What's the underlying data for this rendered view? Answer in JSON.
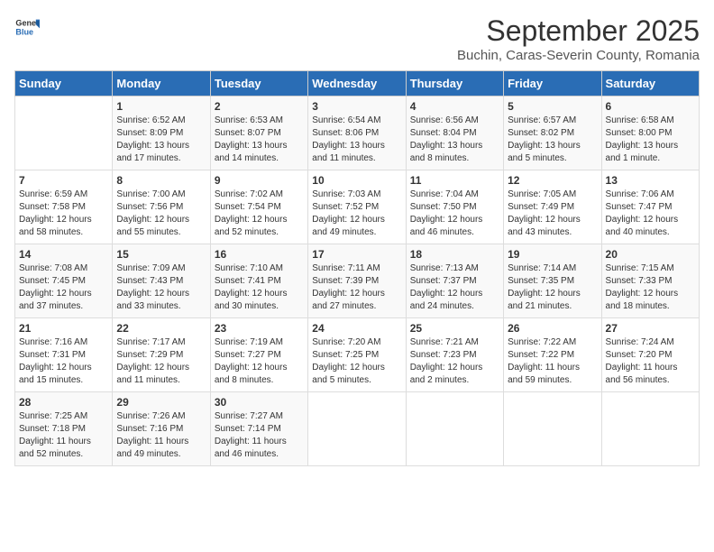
{
  "header": {
    "logo_general": "General",
    "logo_blue": "Blue",
    "title": "September 2025",
    "subtitle": "Buchin, Caras-Severin County, Romania"
  },
  "calendar": {
    "days_of_week": [
      "Sunday",
      "Monday",
      "Tuesday",
      "Wednesday",
      "Thursday",
      "Friday",
      "Saturday"
    ],
    "weeks": [
      [
        {
          "day": "",
          "content": ""
        },
        {
          "day": "1",
          "content": "Sunrise: 6:52 AM\nSunset: 8:09 PM\nDaylight: 13 hours\nand 17 minutes."
        },
        {
          "day": "2",
          "content": "Sunrise: 6:53 AM\nSunset: 8:07 PM\nDaylight: 13 hours\nand 14 minutes."
        },
        {
          "day": "3",
          "content": "Sunrise: 6:54 AM\nSunset: 8:06 PM\nDaylight: 13 hours\nand 11 minutes."
        },
        {
          "day": "4",
          "content": "Sunrise: 6:56 AM\nSunset: 8:04 PM\nDaylight: 13 hours\nand 8 minutes."
        },
        {
          "day": "5",
          "content": "Sunrise: 6:57 AM\nSunset: 8:02 PM\nDaylight: 13 hours\nand 5 minutes."
        },
        {
          "day": "6",
          "content": "Sunrise: 6:58 AM\nSunset: 8:00 PM\nDaylight: 13 hours\nand 1 minute."
        }
      ],
      [
        {
          "day": "7",
          "content": "Sunrise: 6:59 AM\nSunset: 7:58 PM\nDaylight: 12 hours\nand 58 minutes."
        },
        {
          "day": "8",
          "content": "Sunrise: 7:00 AM\nSunset: 7:56 PM\nDaylight: 12 hours\nand 55 minutes."
        },
        {
          "day": "9",
          "content": "Sunrise: 7:02 AM\nSunset: 7:54 PM\nDaylight: 12 hours\nand 52 minutes."
        },
        {
          "day": "10",
          "content": "Sunrise: 7:03 AM\nSunset: 7:52 PM\nDaylight: 12 hours\nand 49 minutes."
        },
        {
          "day": "11",
          "content": "Sunrise: 7:04 AM\nSunset: 7:50 PM\nDaylight: 12 hours\nand 46 minutes."
        },
        {
          "day": "12",
          "content": "Sunrise: 7:05 AM\nSunset: 7:49 PM\nDaylight: 12 hours\nand 43 minutes."
        },
        {
          "day": "13",
          "content": "Sunrise: 7:06 AM\nSunset: 7:47 PM\nDaylight: 12 hours\nand 40 minutes."
        }
      ],
      [
        {
          "day": "14",
          "content": "Sunrise: 7:08 AM\nSunset: 7:45 PM\nDaylight: 12 hours\nand 37 minutes."
        },
        {
          "day": "15",
          "content": "Sunrise: 7:09 AM\nSunset: 7:43 PM\nDaylight: 12 hours\nand 33 minutes."
        },
        {
          "day": "16",
          "content": "Sunrise: 7:10 AM\nSunset: 7:41 PM\nDaylight: 12 hours\nand 30 minutes."
        },
        {
          "day": "17",
          "content": "Sunrise: 7:11 AM\nSunset: 7:39 PM\nDaylight: 12 hours\nand 27 minutes."
        },
        {
          "day": "18",
          "content": "Sunrise: 7:13 AM\nSunset: 7:37 PM\nDaylight: 12 hours\nand 24 minutes."
        },
        {
          "day": "19",
          "content": "Sunrise: 7:14 AM\nSunset: 7:35 PM\nDaylight: 12 hours\nand 21 minutes."
        },
        {
          "day": "20",
          "content": "Sunrise: 7:15 AM\nSunset: 7:33 PM\nDaylight: 12 hours\nand 18 minutes."
        }
      ],
      [
        {
          "day": "21",
          "content": "Sunrise: 7:16 AM\nSunset: 7:31 PM\nDaylight: 12 hours\nand 15 minutes."
        },
        {
          "day": "22",
          "content": "Sunrise: 7:17 AM\nSunset: 7:29 PM\nDaylight: 12 hours\nand 11 minutes."
        },
        {
          "day": "23",
          "content": "Sunrise: 7:19 AM\nSunset: 7:27 PM\nDaylight: 12 hours\nand 8 minutes."
        },
        {
          "day": "24",
          "content": "Sunrise: 7:20 AM\nSunset: 7:25 PM\nDaylight: 12 hours\nand 5 minutes."
        },
        {
          "day": "25",
          "content": "Sunrise: 7:21 AM\nSunset: 7:23 PM\nDaylight: 12 hours\nand 2 minutes."
        },
        {
          "day": "26",
          "content": "Sunrise: 7:22 AM\nSunset: 7:22 PM\nDaylight: 11 hours\nand 59 minutes."
        },
        {
          "day": "27",
          "content": "Sunrise: 7:24 AM\nSunset: 7:20 PM\nDaylight: 11 hours\nand 56 minutes."
        }
      ],
      [
        {
          "day": "28",
          "content": "Sunrise: 7:25 AM\nSunset: 7:18 PM\nDaylight: 11 hours\nand 52 minutes."
        },
        {
          "day": "29",
          "content": "Sunrise: 7:26 AM\nSunset: 7:16 PM\nDaylight: 11 hours\nand 49 minutes."
        },
        {
          "day": "30",
          "content": "Sunrise: 7:27 AM\nSunset: 7:14 PM\nDaylight: 11 hours\nand 46 minutes."
        },
        {
          "day": "",
          "content": ""
        },
        {
          "day": "",
          "content": ""
        },
        {
          "day": "",
          "content": ""
        },
        {
          "day": "",
          "content": ""
        }
      ]
    ]
  }
}
